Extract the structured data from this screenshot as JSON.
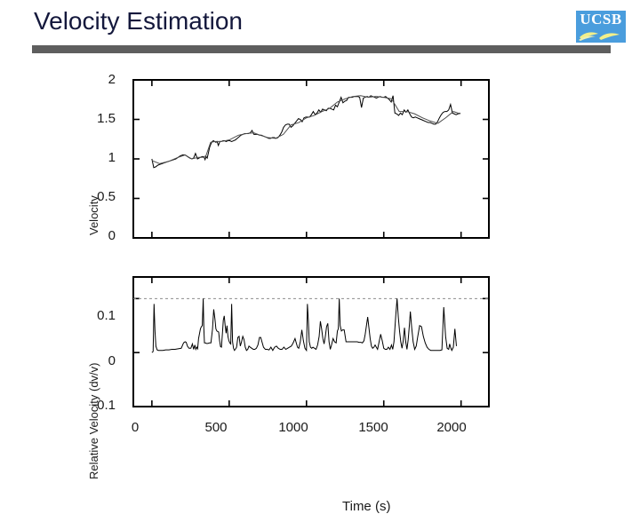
{
  "slide": {
    "title": "Velocity Estimation",
    "rule_color": "#5e5e5e",
    "title_color": "#14183c",
    "background": "#ffffff"
  },
  "logo": {
    "name": "ucsb-logo",
    "wordmark": "UCSB",
    "box_color": "#4a9ddd",
    "text_color": "#ffffff",
    "wave_color": "#f2ef8a"
  },
  "chart_data": [
    {
      "id": "velocity-plot",
      "type": "line",
      "title": "",
      "xlabel": "",
      "ylabel": "Velocity",
      "xlim": [
        -120,
        2180
      ],
      "ylim": [
        0,
        2
      ],
      "xticks": [
        0,
        500,
        1000,
        1500,
        2000
      ],
      "xticklabels": [
        "",
        "",
        "",
        "",
        ""
      ],
      "yticks": [
        0,
        0.5,
        1,
        1.5,
        2
      ],
      "yticklabels": [
        "0",
        "0.5",
        "1",
        "1.5",
        "2"
      ],
      "grid": false,
      "legend": "none",
      "series": [
        {
          "name": "measured-velocity",
          "color": "#000000",
          "x": [
            0,
            12,
            25,
            38,
            50,
            65,
            80,
            95,
            110,
            125,
            140,
            155,
            170,
            185,
            200,
            215,
            230,
            245,
            258,
            270,
            282,
            295,
            305,
            315,
            325,
            332,
            338,
            344,
            350,
            358,
            366,
            374,
            382,
            390,
            398,
            406,
            414,
            422,
            430,
            440,
            450,
            460,
            470,
            480,
            492,
            504,
            516,
            528,
            540,
            552,
            564,
            576,
            588,
            600,
            612,
            624,
            636,
            648,
            660,
            672,
            684,
            696,
            708,
            720,
            732,
            744,
            756,
            768,
            780,
            792,
            804,
            816,
            828,
            840,
            852,
            864,
            876,
            888,
            900,
            912,
            924,
            936,
            948,
            960,
            972,
            984,
            996,
            1008,
            1020,
            1032,
            1044,
            1056,
            1068,
            1080,
            1092,
            1104,
            1116,
            1128,
            1140,
            1152,
            1164,
            1176,
            1188,
            1200,
            1212,
            1224,
            1236,
            1248,
            1260,
            1272,
            1284,
            1296,
            1308,
            1320,
            1332,
            1344,
            1356,
            1368,
            1380,
            1392,
            1404,
            1416,
            1428,
            1440,
            1452,
            1464,
            1476,
            1488,
            1500,
            1512,
            1524,
            1536,
            1548,
            1560,
            1572,
            1584,
            1596,
            1608,
            1620,
            1632,
            1644,
            1656,
            1668,
            1680,
            1692,
            1704,
            1716,
            1728,
            1740,
            1752,
            1764,
            1776,
            1788,
            1800,
            1812,
            1824,
            1836,
            1848,
            1860,
            1872,
            1884,
            1896,
            1908,
            1920,
            1932,
            1944,
            1956,
            1968,
            1980,
            1995
          ],
          "y": [
            1.0,
            0.89,
            0.9,
            0.92,
            0.93,
            0.94,
            0.95,
            0.96,
            0.97,
            0.98,
            0.99,
            1.0,
            1.02,
            1.04,
            1.05,
            1.05,
            1.03,
            1.01,
            1.0,
            1.01,
            1.07,
            1.0,
            1.01,
            1.02,
            1.03,
            1.03,
            1.02,
            0.99,
            1.03,
            1.01,
            1.08,
            1.15,
            1.19,
            1.22,
            1.23,
            1.22,
            1.21,
            1.22,
            1.17,
            1.22,
            1.22,
            1.23,
            1.23,
            1.22,
            1.23,
            1.23,
            1.22,
            1.23,
            1.24,
            1.26,
            1.28,
            1.3,
            1.31,
            1.32,
            1.32,
            1.32,
            1.33,
            1.36,
            1.31,
            1.31,
            1.31,
            1.3,
            1.3,
            1.29,
            1.28,
            1.27,
            1.26,
            1.26,
            1.27,
            1.27,
            1.26,
            1.27,
            1.3,
            1.34,
            1.4,
            1.43,
            1.44,
            1.44,
            1.4,
            1.42,
            1.45,
            1.48,
            1.51,
            1.5,
            1.47,
            1.52,
            1.53,
            1.53,
            1.53,
            1.56,
            1.6,
            1.56,
            1.58,
            1.62,
            1.59,
            1.63,
            1.62,
            1.61,
            1.64,
            1.64,
            1.63,
            1.62,
            1.68,
            1.66,
            1.72,
            1.78,
            1.71,
            1.73,
            1.74,
            1.78,
            1.78,
            1.78,
            1.79,
            1.79,
            1.79,
            1.78,
            1.65,
            1.77,
            1.78,
            1.79,
            1.78,
            1.8,
            1.79,
            1.78,
            1.77,
            1.78,
            1.79,
            1.78,
            1.78,
            1.79,
            1.77,
            1.75,
            1.72,
            1.8,
            1.58,
            1.57,
            1.55,
            1.58,
            1.56,
            1.62,
            1.59,
            1.62,
            1.57,
            1.53,
            1.52,
            1.53,
            1.52,
            1.51,
            1.5,
            1.49,
            1.48,
            1.47,
            1.46,
            1.46,
            1.45,
            1.44,
            1.44,
            1.47,
            1.52,
            1.56,
            1.59,
            1.6,
            1.6,
            1.62,
            1.69,
            1.58,
            1.57,
            1.56,
            1.57,
            1.58,
            1.57
          ]
        },
        {
          "name": "smoothed-velocity",
          "color": "#4d4d4d",
          "x": [
            0,
            50,
            110,
            170,
            215,
            258,
            300,
            330,
            350,
            380,
            410,
            450,
            500,
            560,
            610,
            660,
            700,
            750,
            800,
            850,
            900,
            950,
            1000,
            1050,
            1100,
            1150,
            1200,
            1250,
            1300,
            1350,
            1400,
            1450,
            1500,
            1550,
            1600,
            1650,
            1700,
            1750,
            1800,
            1850,
            1900,
            1950,
            1995
          ],
          "y": [
            0.98,
            0.94,
            0.97,
            1.02,
            1.05,
            1.0,
            1.02,
            1.02,
            1.04,
            1.21,
            1.22,
            1.22,
            1.24,
            1.3,
            1.32,
            1.33,
            1.3,
            1.27,
            1.26,
            1.31,
            1.43,
            1.46,
            1.52,
            1.55,
            1.6,
            1.64,
            1.72,
            1.76,
            1.79,
            1.8,
            1.78,
            1.79,
            1.78,
            1.76,
            1.6,
            1.6,
            1.57,
            1.52,
            1.48,
            1.45,
            1.52,
            1.6,
            1.57
          ]
        }
      ]
    },
    {
      "id": "relative-velocity-plot",
      "type": "line",
      "title": "",
      "xlabel": "Time (s)",
      "ylabel": "Relative Velocity (dv/v)",
      "xlim": [
        -120,
        2180
      ],
      "ylim": [
        -0.1,
        0.14
      ],
      "xticks": [
        0,
        500,
        1000,
        1500,
        2000
      ],
      "xticklabels": [
        "0",
        "500",
        "1000",
        "1500",
        "2000"
      ],
      "yticks": [
        -0.1,
        0,
        0.1
      ],
      "yticklabels": [
        "-0.1",
        "0",
        "0.1"
      ],
      "grid": false,
      "legend": "none",
      "threshold_line": {
        "value": 0.1,
        "style": "dashed",
        "color": "#8c8c8c"
      },
      "series": [
        {
          "name": "relative-velocity-residual",
          "color": "#000000",
          "x": [
            0,
            8,
            14,
            20,
            26,
            34,
            42,
            55,
            70,
            90,
            110,
            130,
            150,
            170,
            190,
            205,
            215,
            222,
            230,
            240,
            252,
            262,
            270,
            278,
            284,
            290,
            296,
            302,
            308,
            314,
            320,
            326,
            332,
            336,
            340,
            346,
            352,
            362,
            372,
            382,
            392,
            400,
            408,
            414,
            420,
            426,
            432,
            438,
            444,
            450,
            456,
            462,
            468,
            474,
            480,
            486,
            492,
            498,
            504,
            510,
            516,
            522,
            528,
            534,
            540,
            548,
            556,
            564,
            572,
            580,
            588,
            596,
            604,
            612,
            620,
            628,
            636,
            646,
            656,
            666,
            676,
            686,
            696,
            704,
            712,
            722,
            734,
            746,
            758,
            770,
            782,
            794,
            806,
            818,
            830,
            842,
            854,
            866,
            878,
            890,
            902,
            914,
            926,
            934,
            942,
            950,
            960,
            970,
            980,
            990,
            1000,
            1006,
            1012,
            1018,
            1026,
            1034,
            1042,
            1052,
            1062,
            1072,
            1082,
            1090,
            1098,
            1106,
            1114,
            1122,
            1130,
            1138,
            1146,
            1154,
            1162,
            1172,
            1182,
            1192,
            1200,
            1206,
            1212,
            1218,
            1226,
            1234,
            1244,
            1256,
            1268,
            1280,
            1292,
            1304,
            1316,
            1328,
            1340,
            1352,
            1362,
            1372,
            1380,
            1388,
            1396,
            1404,
            1412,
            1420,
            1428,
            1436,
            1444,
            1452,
            1460,
            1470,
            1480,
            1490,
            1500,
            1510,
            1520,
            1530,
            1540,
            1550,
            1558,
            1566,
            1572,
            1578,
            1586,
            1594,
            1602,
            1610,
            1618,
            1626,
            1634,
            1642,
            1650,
            1658,
            1666,
            1672,
            1680,
            1690,
            1700,
            1710,
            1720,
            1732,
            1744,
            1756,
            1768,
            1780,
            1792,
            1804,
            1816,
            1828,
            1840,
            1852,
            1864,
            1876,
            1888,
            1900,
            1910,
            1920,
            1926,
            1932,
            1940,
            1950,
            1960,
            1970,
            1978,
            1986,
            1995
          ],
          "y": [
            0.0,
            0.002,
            0.09,
            0.04,
            0.012,
            0.005,
            0.004,
            0.004,
            0.004,
            0.005,
            0.005,
            0.006,
            0.006,
            0.007,
            0.008,
            0.018,
            0.02,
            0.019,
            0.012,
            0.008,
            0.008,
            0.016,
            0.006,
            0.014,
            0.006,
            0.01,
            0.007,
            0.026,
            0.035,
            0.044,
            0.048,
            0.05,
            0.1,
            0.046,
            0.018,
            0.018,
            0.017,
            0.017,
            0.018,
            0.018,
            0.043,
            0.08,
            0.062,
            0.044,
            0.04,
            0.039,
            0.038,
            0.022,
            0.011,
            0.01,
            0.034,
            0.06,
            0.068,
            0.05,
            0.036,
            0.05,
            0.03,
            0.022,
            0.018,
            0.016,
            0.09,
            0.02,
            0.008,
            0.004,
            0.006,
            0.01,
            0.028,
            0.03,
            0.012,
            0.02,
            0.03,
            0.024,
            0.01,
            0.004,
            0.006,
            0.012,
            0.01,
            0.008,
            0.006,
            0.006,
            0.008,
            0.014,
            0.028,
            0.028,
            0.02,
            0.01,
            0.006,
            0.006,
            0.005,
            0.01,
            0.004,
            0.01,
            0.012,
            0.008,
            0.006,
            0.006,
            0.01,
            0.006,
            0.008,
            0.01,
            0.012,
            0.018,
            0.026,
            0.018,
            0.01,
            0.008,
            0.02,
            0.042,
            0.022,
            0.008,
            0.004,
            0.09,
            0.06,
            0.02,
            0.01,
            0.008,
            0.01,
            0.008,
            0.006,
            0.014,
            0.03,
            0.058,
            0.044,
            0.026,
            0.016,
            0.03,
            0.048,
            0.054,
            0.02,
            0.006,
            0.014,
            0.026,
            0.02,
            0.018,
            0.04,
            0.044,
            0.1,
            0.05,
            0.04,
            0.042,
            0.042,
            0.02,
            0.02,
            0.02,
            0.02,
            0.02,
            0.02,
            0.02,
            0.019,
            0.019,
            0.018,
            0.022,
            0.034,
            0.05,
            0.066,
            0.046,
            0.026,
            0.012,
            0.008,
            0.01,
            0.014,
            0.01,
            0.006,
            0.02,
            0.034,
            0.022,
            0.008,
            0.006,
            0.006,
            0.01,
            0.006,
            0.014,
            0.006,
            0.02,
            0.045,
            0.07,
            0.1,
            0.066,
            0.04,
            0.02,
            0.008,
            0.022,
            0.046,
            0.02,
            0.006,
            0.024,
            0.052,
            0.076,
            0.048,
            0.02,
            0.006,
            0.012,
            0.03,
            0.05,
            0.048,
            0.03,
            0.018,
            0.01,
            0.006,
            0.004,
            0.004,
            0.004,
            0.004,
            0.004,
            0.004,
            0.005,
            0.084,
            0.03,
            0.008,
            0.006,
            0.016,
            0.01,
            0.004,
            0.01,
            0.044,
            0.012
          ]
        }
      ]
    }
  ]
}
